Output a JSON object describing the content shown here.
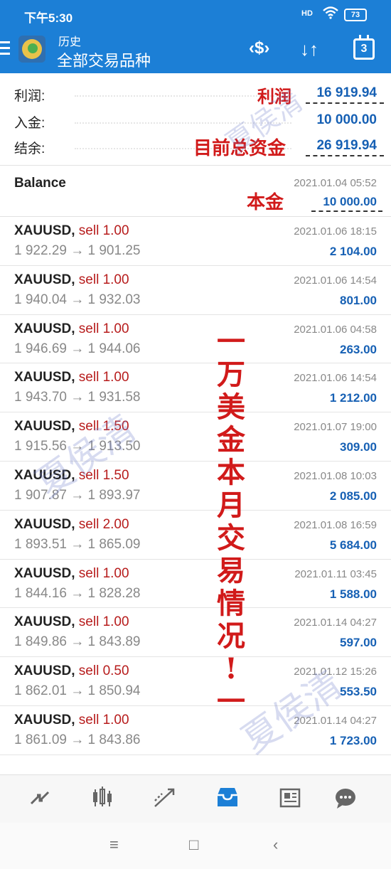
{
  "status_bar": {
    "time": "下午5:30",
    "signal": "HD",
    "battery": "73"
  },
  "app_bar": {
    "subtitle": "历史",
    "title": "全部交易品种",
    "calendar_day": "3"
  },
  "summary": [
    {
      "label": "利润:",
      "value": "16 919.94"
    },
    {
      "label": "入金:",
      "value": "10 000.00"
    },
    {
      "label": "结余:",
      "value": "26 919.94"
    }
  ],
  "annotations": {
    "profit": "利润",
    "total_funds": "目前总资金",
    "principal": "本金",
    "vertical": [
      "一",
      "万",
      "美",
      "金",
      "本",
      "月",
      "交",
      "易",
      "情",
      "况",
      "!",
      "一"
    ]
  },
  "balance": {
    "label": "Balance",
    "date": "2021.01.04 05:52",
    "amount": "10 000.00"
  },
  "trades": [
    {
      "symbol": "XAUUSD,",
      "action": "sell 1.00",
      "prices": "1 922.29 → 1 901.25",
      "date": "2021.01.06 18:15",
      "profit": "2 104.00"
    },
    {
      "symbol": "XAUUSD,",
      "action": "sell 1.00",
      "prices": "1 940.04 → 1 932.03",
      "date": "2021.01.06 14:54",
      "profit": "801.00"
    },
    {
      "symbol": "XAUUSD,",
      "action": "sell 1.00",
      "prices": "1 946.69 → 1 944.06",
      "date": "2021.01.06 04:58",
      "profit": "263.00"
    },
    {
      "symbol": "XAUUSD,",
      "action": "sell 1.00",
      "prices": "1 943.70 → 1 931.58",
      "date": "2021.01.06 14:54",
      "profit": "1 212.00"
    },
    {
      "symbol": "XAUUSD,",
      "action": "sell 1.50",
      "prices": "1 915.56 → 1 913.50",
      "date": "2021.01.07 19:00",
      "profit": "309.00"
    },
    {
      "symbol": "XAUUSD,",
      "action": "sell 1.50",
      "prices": "1 907.87 → 1 893.97",
      "date": "2021.01.08 10:03",
      "profit": "2 085.00"
    },
    {
      "symbol": "XAUUSD,",
      "action": "sell 2.00",
      "prices": "1 893.51 → 1 865.09",
      "date": "2021.01.08 16:59",
      "profit": "5 684.00"
    },
    {
      "symbol": "XAUUSD,",
      "action": "sell 1.00",
      "prices": "1 844.16 → 1 828.28",
      "date": "2021.01.11 03:45",
      "profit": "1 588.00"
    },
    {
      "symbol": "XAUUSD,",
      "action": "sell 1.00",
      "prices": "1 849.86 → 1 843.89",
      "date": "2021.01.14 04:27",
      "profit": "597.00"
    },
    {
      "symbol": "XAUUSD,",
      "action": "sell 0.50",
      "prices": "1 862.01 → 1 850.94",
      "date": "2021.01.12 15:26",
      "profit": "553.50"
    },
    {
      "symbol": "XAUUSD,",
      "action": "sell 1.00",
      "prices": "1 861.09 → 1 843.86",
      "date": "2021.01.14 04:27",
      "profit": "1 723.00"
    }
  ],
  "watermark": "夏侯清",
  "bottom_nav": [
    {
      "icon": "quotes-icon",
      "active": false
    },
    {
      "icon": "chart-icon",
      "active": false
    },
    {
      "icon": "trade-icon",
      "active": false
    },
    {
      "icon": "history-icon",
      "active": true
    },
    {
      "icon": "news-icon",
      "active": false
    },
    {
      "icon": "chat-icon",
      "active": false
    }
  ],
  "colors": {
    "primary": "#1c7fd6",
    "profit": "#1660b4",
    "sell": "#b71c1c",
    "annotation": "#d11a1a"
  }
}
